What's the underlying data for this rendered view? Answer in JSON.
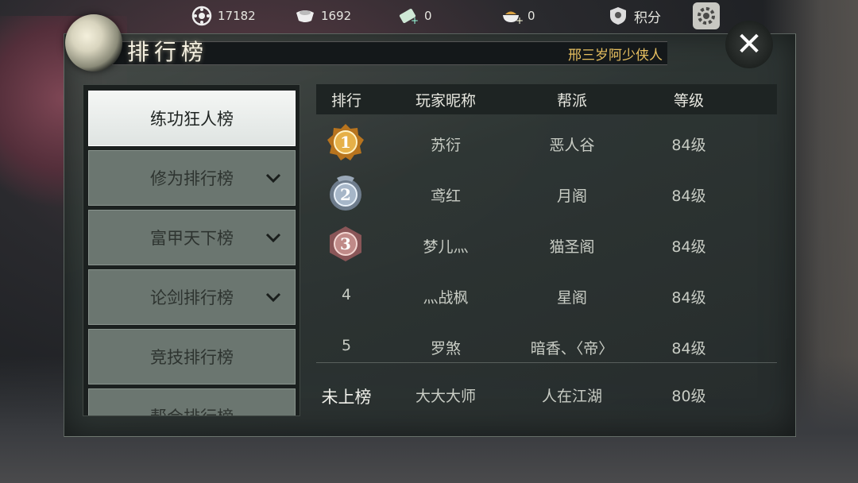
{
  "resources": [
    {
      "icon": "coin-icon",
      "value": "17182"
    },
    {
      "icon": "ingot-icon",
      "value": "1692"
    },
    {
      "icon": "ticket-icon",
      "value": "0"
    },
    {
      "icon": "bowl-icon",
      "value": "0"
    }
  ],
  "points_label": "积分",
  "panel": {
    "title": "排行榜",
    "subtitle": "邢三岁阿少侠人",
    "close_glyph": "✕"
  },
  "menu": [
    {
      "label": "练功狂人榜",
      "active": true,
      "expandable": false
    },
    {
      "label": "修为排行榜",
      "active": false,
      "expandable": true
    },
    {
      "label": "富甲天下榜",
      "active": false,
      "expandable": true
    },
    {
      "label": "论剑排行榜",
      "active": false,
      "expandable": true
    },
    {
      "label": "竞技排行榜",
      "active": false,
      "expandable": false
    },
    {
      "label": "帮会排行榜",
      "active": false,
      "expandable": false
    }
  ],
  "table": {
    "headers": [
      "排行",
      "玩家昵称",
      "帮派",
      "等级"
    ],
    "rows": [
      {
        "rank": "1",
        "name": "苏衍",
        "guild": "恶人谷",
        "level": "84级",
        "medal": "gold"
      },
      {
        "rank": "2",
        "name": "鸢红",
        "guild": "月阁",
        "level": "84级",
        "medal": "silver"
      },
      {
        "rank": "3",
        "name": "梦儿灬",
        "guild": "猫圣阁",
        "level": "84级",
        "medal": "bronze"
      },
      {
        "rank": "4",
        "name": "灬战枫",
        "guild": "星阁",
        "level": "84级",
        "medal": ""
      },
      {
        "rank": "5",
        "name": "罗煞",
        "guild": "暗香、〈帝〉",
        "level": "84级",
        "medal": ""
      }
    ],
    "me": {
      "rank": "未上榜",
      "name": "大大大师",
      "guild": "人在江湖",
      "level": "80级"
    }
  },
  "colors": {
    "gold": "#d9a23a",
    "silver": "#9aa8b8",
    "bronze": "#b87a78",
    "accent_subtitle": "#e8c060"
  }
}
